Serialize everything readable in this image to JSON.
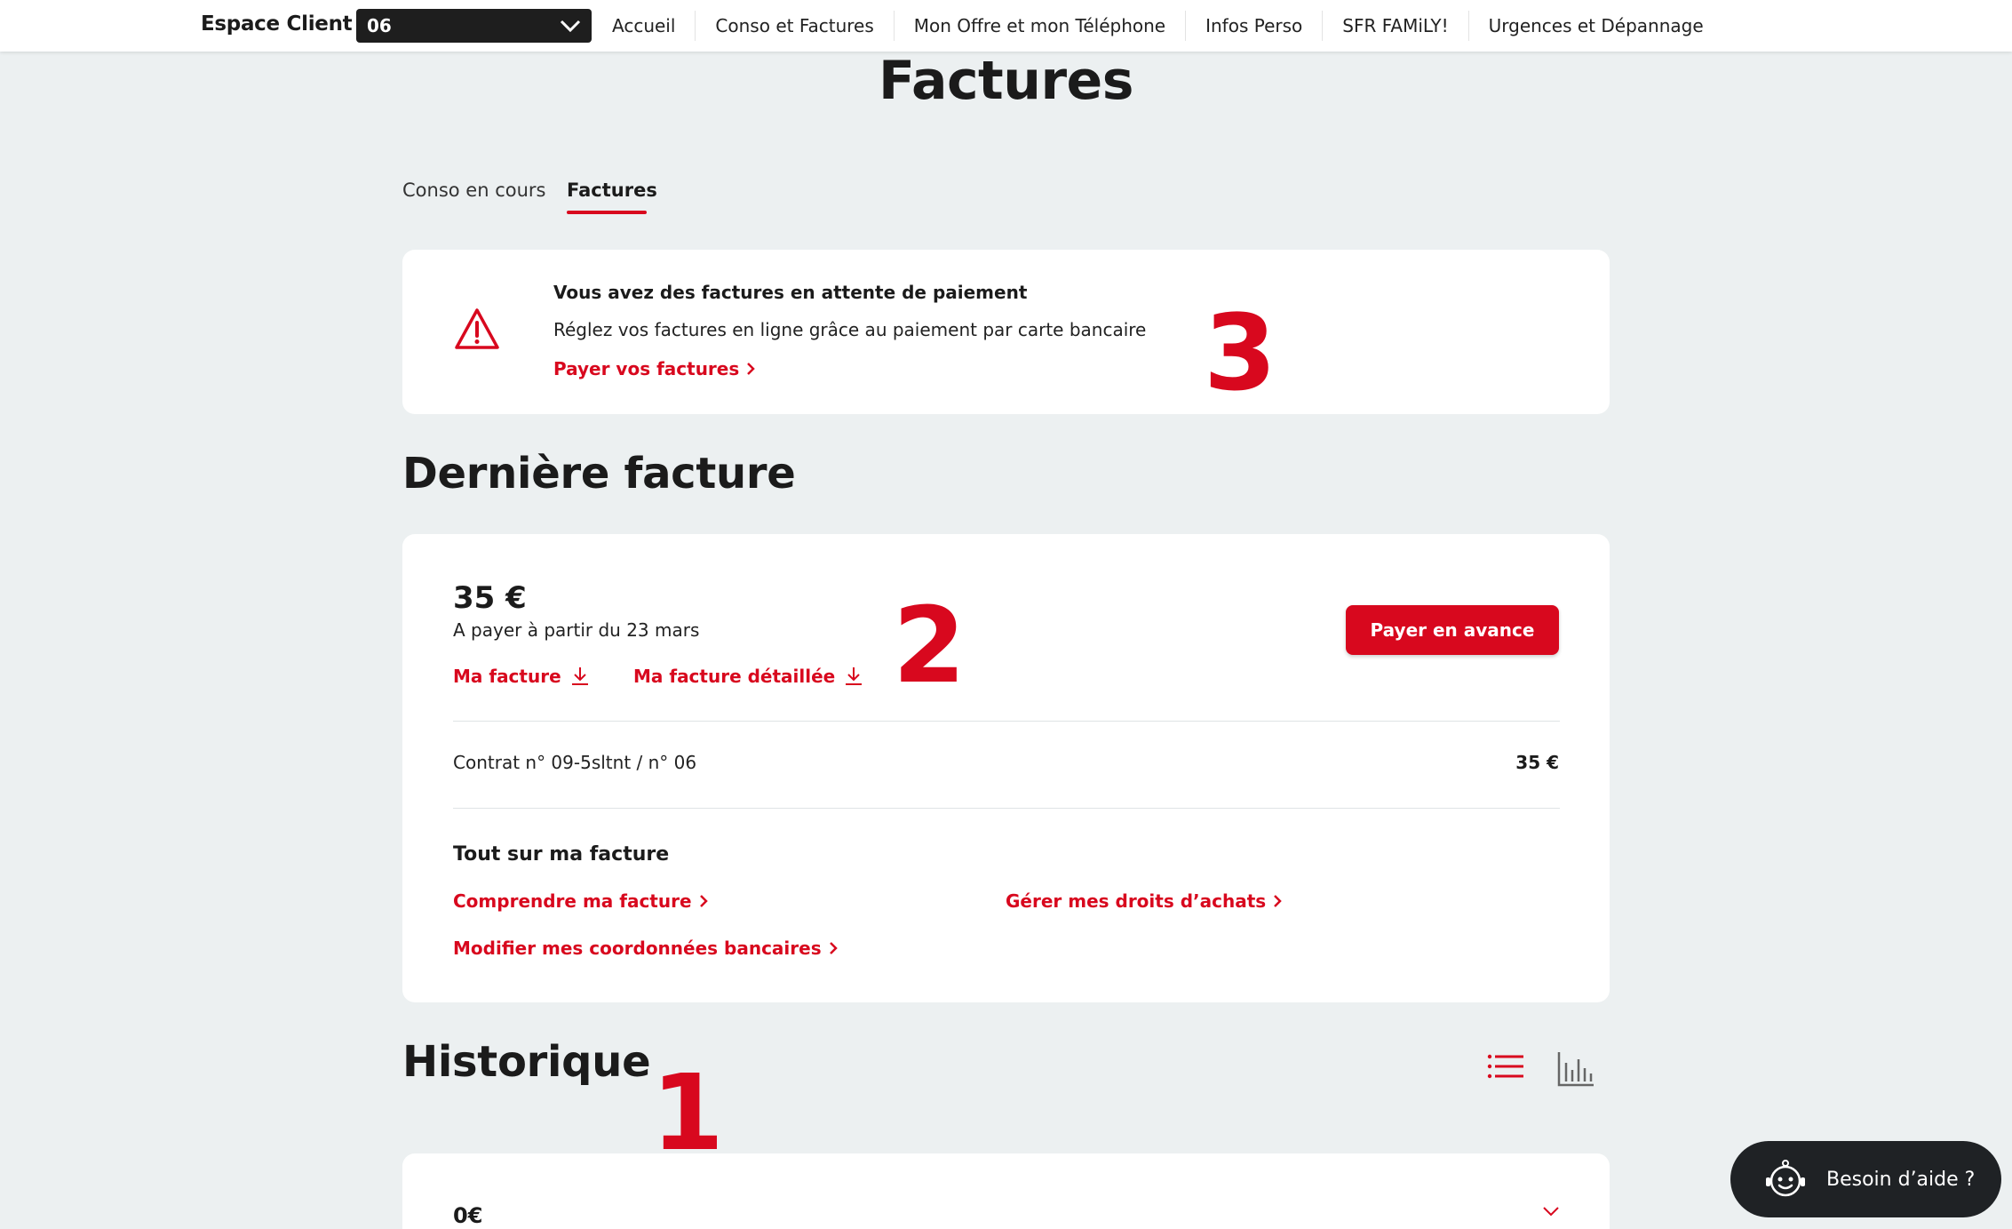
{
  "nav": {
    "brand": "Espace Client",
    "line_selector": "06",
    "links": [
      "Accueil",
      "Conso et Factures",
      "Mon Offre et mon Téléphone",
      "Infos Perso",
      "SFR FAMiLY!",
      "Urgences et Dépannage"
    ]
  },
  "page_title": "Factures",
  "tabs": [
    {
      "label": "Conso en cours",
      "active": false
    },
    {
      "label": "Factures",
      "active": true
    }
  ],
  "alert": {
    "title": "Vous avez des factures en attente de paiement",
    "text": "Réglez vos factures en ligne grâce au paiement par carte bancaire",
    "link": "Payer vos factures",
    "icon": "warning-triangle-icon"
  },
  "annotations": {
    "one": "1",
    "two": "2",
    "three": "3"
  },
  "derniere": {
    "title": "Dernière facture",
    "amount": "35 €",
    "due": "A payer à partir du 23 mars",
    "download_1": "Ma facture",
    "download_2": "Ma facture détaillée",
    "pay_button": "Payer en avance",
    "contract": "Contrat n° 09-5sltnt / n° 06",
    "contract_amount": "35 €",
    "tout_title": "Tout sur ma facture",
    "links": [
      "Comprendre ma facture",
      "Gérer mes droits d’achats",
      "Modifier mes coordonnées bancaires"
    ]
  },
  "historique": {
    "title": "Historique",
    "first_amount": "0€"
  },
  "help": {
    "label": "Besoin d’aide ?"
  },
  "colors": {
    "accent": "#d8081e",
    "background": "#ecf0f1",
    "dark": "#1f2225"
  }
}
